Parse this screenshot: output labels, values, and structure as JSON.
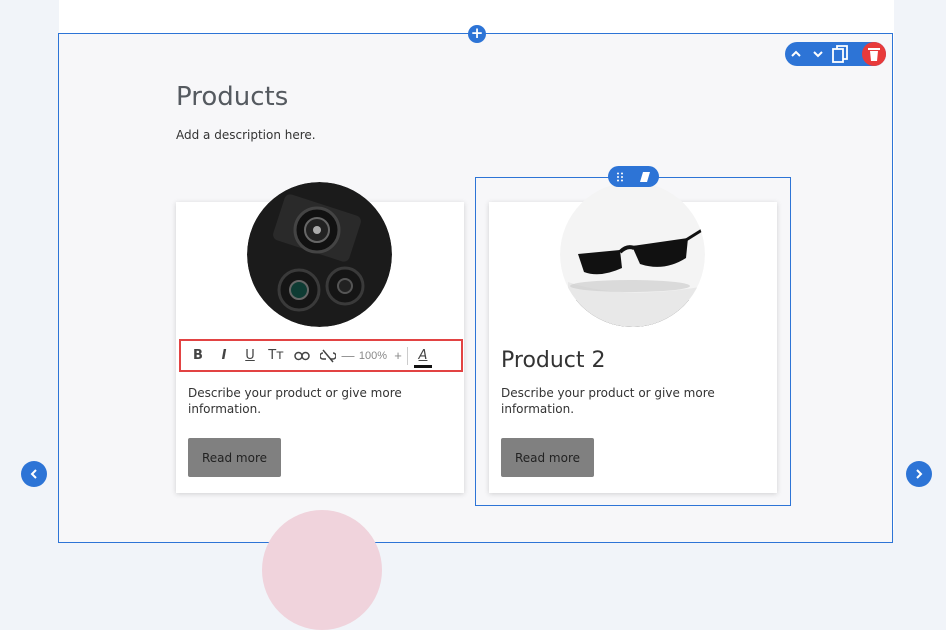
{
  "section": {
    "title": "Products",
    "description": "Add a description here."
  },
  "toolbar": {
    "icons": [
      "chevron-up-icon",
      "chevron-down-icon",
      "duplicate-icon",
      "trash-icon"
    ]
  },
  "text_toolbar": {
    "bold": "B",
    "italic": "I",
    "underline": "U",
    "text_size": "Tт",
    "minus": "—",
    "zoom": "100%",
    "plus": "+",
    "font_color": "A"
  },
  "products": [
    {
      "title": "",
      "description": "Describe your product or give more information.",
      "button": "Read more"
    },
    {
      "title": "Product 2",
      "description": "Describe your product or give more information.",
      "button": "Read more"
    }
  ],
  "colors": {
    "accent": "#2d74d6",
    "delete": "#e83a3a",
    "highlight": "#e24343",
    "button": "#808080"
  }
}
